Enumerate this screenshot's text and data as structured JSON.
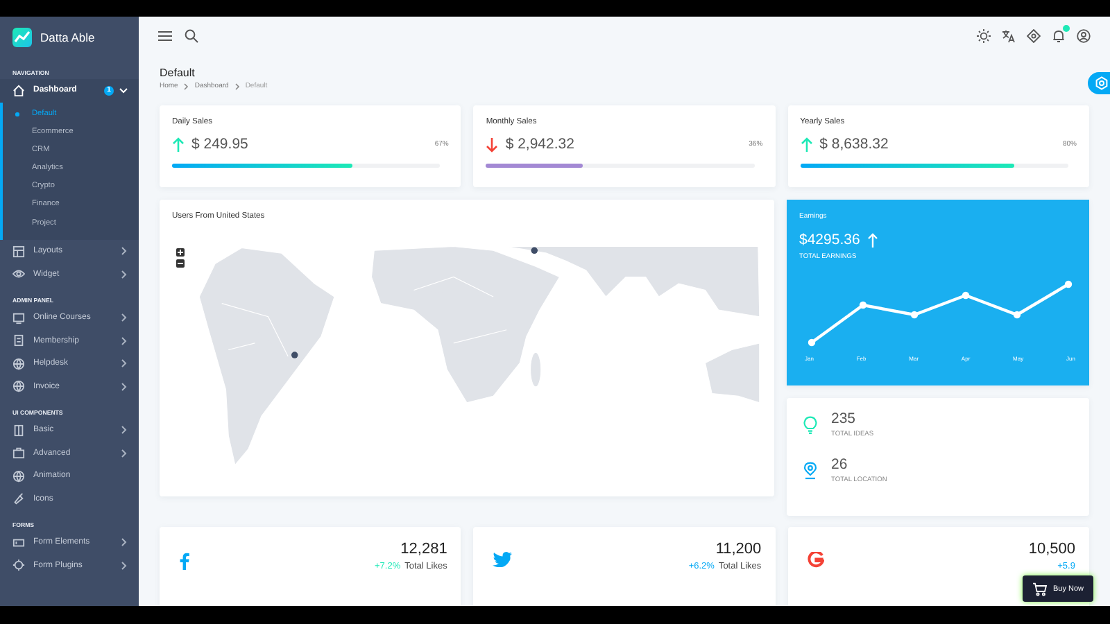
{
  "brand": {
    "name": "Datta Able"
  },
  "sidebar": {
    "sections": [
      {
        "title": "NAVIGATION",
        "items": [
          {
            "label": "Dashboard",
            "badge": "1",
            "submenu": true,
            "expanded": true,
            "selected": true,
            "children": [
              {
                "label": "Default",
                "selected": true
              },
              {
                "label": "Ecommerce",
                "selected": false
              },
              {
                "label": "CRM",
                "selected": false
              },
              {
                "label": "Analytics",
                "selected": false
              },
              {
                "label": "Crypto",
                "selected": false
              },
              {
                "label": "Finance",
                "selected": false
              },
              {
                "label": "Project",
                "selected": false
              }
            ]
          },
          {
            "label": "Layouts",
            "submenu": true,
            "expanded": false,
            "selected": false
          },
          {
            "label": "Widget",
            "submenu": true,
            "expanded": false,
            "selected": false
          }
        ]
      },
      {
        "title": "ADMIN PANEL",
        "items": [
          {
            "label": "Online Courses",
            "submenu": true,
            "expanded": false,
            "selected": false
          },
          {
            "label": "Membership",
            "submenu": true,
            "expanded": false,
            "selected": false
          },
          {
            "label": "Helpdesk",
            "submenu": true,
            "expanded": false,
            "selected": false
          },
          {
            "label": "Invoice",
            "submenu": true,
            "expanded": false,
            "selected": false
          }
        ]
      },
      {
        "title": "UI COMPONENTS",
        "items": [
          {
            "label": "Basic",
            "submenu": true,
            "expanded": false,
            "selected": false
          },
          {
            "label": "Advanced",
            "submenu": true,
            "expanded": false,
            "selected": false
          },
          {
            "label": "Animation",
            "submenu": false,
            "selected": false
          },
          {
            "label": "Icons",
            "submenu": false,
            "selected": false
          }
        ]
      },
      {
        "title": "FORMS",
        "items": [
          {
            "label": "Form Elements",
            "submenu": true,
            "expanded": false,
            "selected": false
          },
          {
            "label": "Form Plugins",
            "submenu": true,
            "expanded": false,
            "selected": false
          }
        ]
      }
    ]
  },
  "header": {
    "notifications_unread": true
  },
  "page": {
    "title": "Default",
    "breadcrumb": [
      "Home",
      "Dashboard",
      "Default"
    ]
  },
  "sales": [
    {
      "title": "Daily Sales",
      "amount": "$ 249.95",
      "trend_up": true,
      "percent": "67%",
      "level": 0.67,
      "color": "#1de9b6"
    },
    {
      "title": "Monthly Sales",
      "amount": "$ 2,942.32",
      "trend_up": false,
      "percent": "36%",
      "level": 0.36,
      "color": "#a389d4"
    },
    {
      "title": "Yearly Sales",
      "amount": "$ 8,638.32",
      "trend_up": true,
      "percent": "80%",
      "level": 0.8,
      "color": "#1de9b6"
    }
  ],
  "map": {
    "title": "Users From United States"
  },
  "earnings": {
    "title": "Earnings",
    "amount": "$4295.36",
    "trend_up": true,
    "label": "TOTAL EARNINGS",
    "months": [
      "Jan",
      "Feb",
      "Mar",
      "Apr",
      "May",
      "Jun"
    ]
  },
  "totals": [
    {
      "value": "235",
      "label": "TOTAL IDEAS"
    },
    {
      "value": "26",
      "label": "TOTAL LOCATION"
    }
  ],
  "social": [
    {
      "kind": "facebook",
      "value": "12,281",
      "change": "+7.2%",
      "label": "Total Likes",
      "color": "#1de9b6"
    },
    {
      "kind": "twitter",
      "value": "11,200",
      "change": "+6.2%",
      "label": "Total Likes",
      "color": "#04a9f5"
    },
    {
      "kind": "google",
      "value": "10,500",
      "change": "+5.9",
      "color": "#04a9f5"
    }
  ],
  "buy_button": {
    "label": "Buy Now"
  }
}
